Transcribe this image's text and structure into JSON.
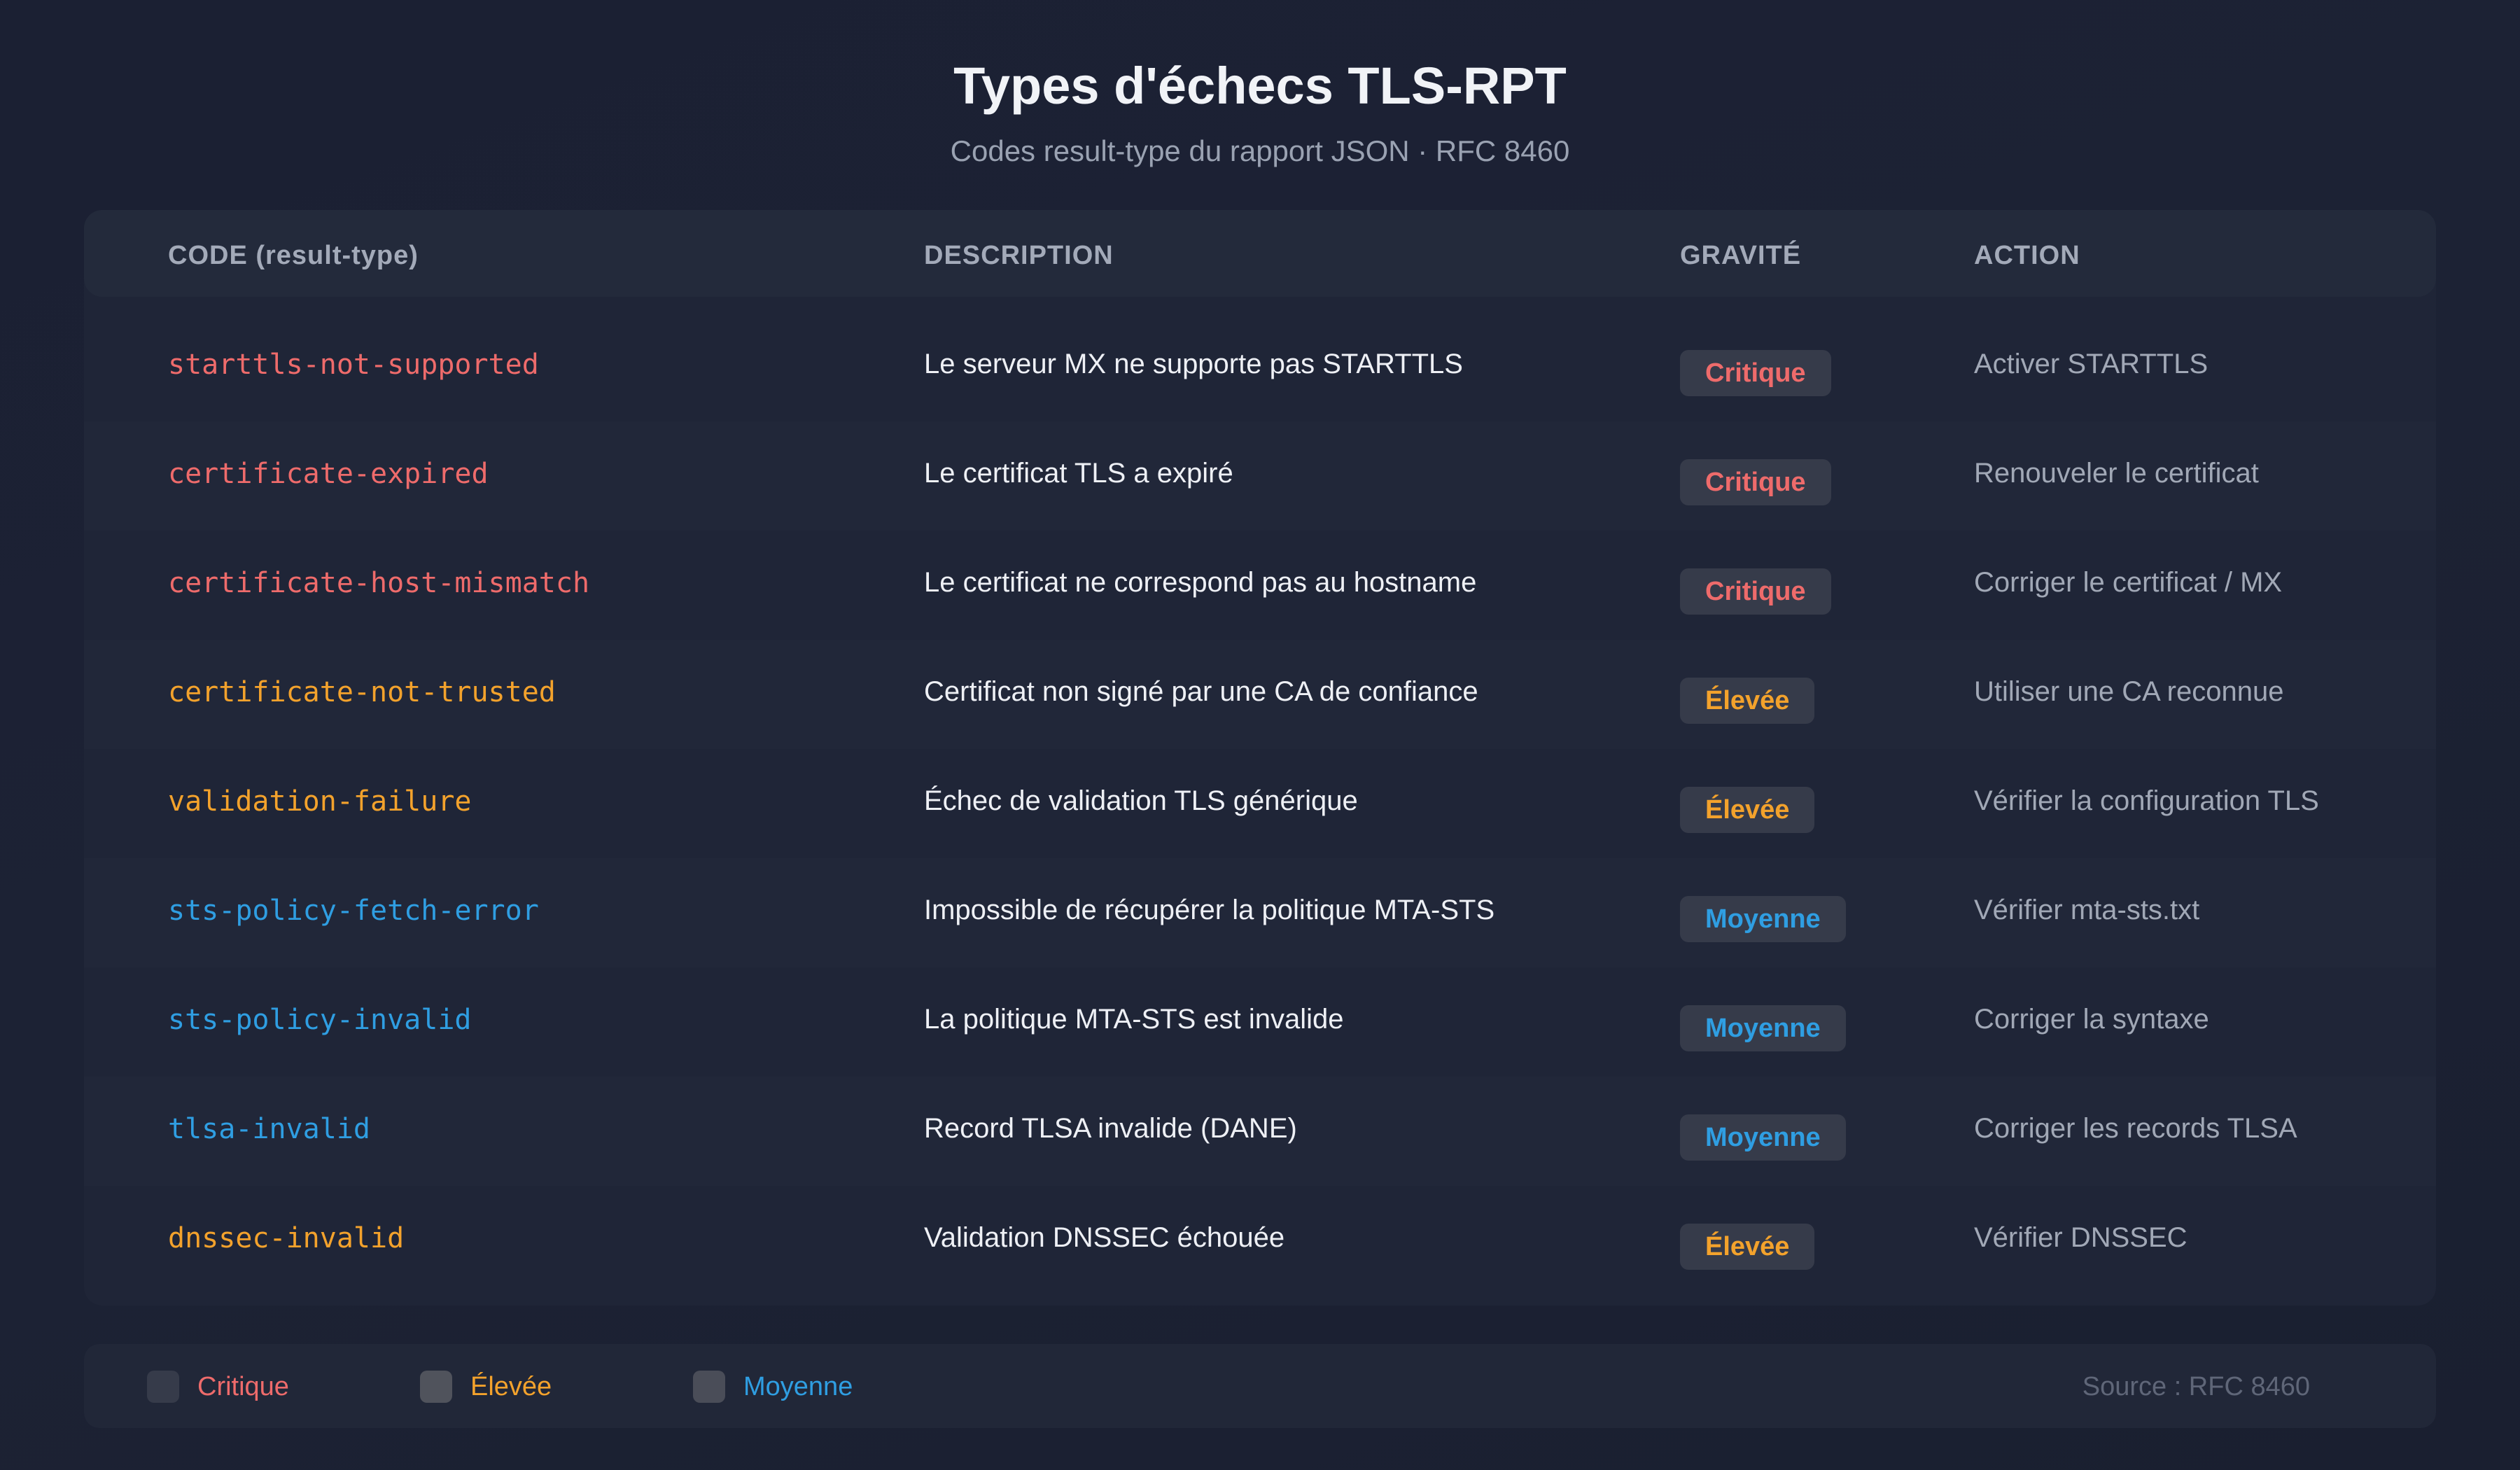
{
  "header": {
    "title": "Types d'échecs TLS-RPT",
    "subtitle": "Codes result-type du rapport JSON · RFC 8460"
  },
  "colors": {
    "background": "#1a1f31",
    "critique": "#ee6b6b",
    "elevee": "#f3a22c",
    "moyenne": "#2f9ee2"
  },
  "table": {
    "columns": [
      "CODE (result-type)",
      "DESCRIPTION",
      "GRAVITÉ",
      "ACTION"
    ],
    "rows": [
      {
        "code": "starttls-not-supported",
        "description": "Le serveur MX ne supporte pas STARTTLS",
        "severity": "Critique",
        "action": "Activer STARTTLS"
      },
      {
        "code": "certificate-expired",
        "description": "Le certificat TLS a expiré",
        "severity": "Critique",
        "action": "Renouveler le certificat"
      },
      {
        "code": "certificate-host-mismatch",
        "description": "Le certificat ne correspond pas au hostname",
        "severity": "Critique",
        "action": "Corriger le certificat / MX"
      },
      {
        "code": "certificate-not-trusted",
        "description": "Certificat non signé par une CA de confiance",
        "severity": "Élevée",
        "action": "Utiliser une CA reconnue"
      },
      {
        "code": "validation-failure",
        "description": "Échec de validation TLS générique",
        "severity": "Élevée",
        "action": "Vérifier la configuration TLS"
      },
      {
        "code": "sts-policy-fetch-error",
        "description": "Impossible de récupérer la politique MTA-STS",
        "severity": "Moyenne",
        "action": "Vérifier mta-sts.txt"
      },
      {
        "code": "sts-policy-invalid",
        "description": "La politique MTA-STS est invalide",
        "severity": "Moyenne",
        "action": "Corriger la syntaxe"
      },
      {
        "code": "tlsa-invalid",
        "description": "Record TLSA invalide (DANE)",
        "severity": "Moyenne",
        "action": "Corriger les records TLSA"
      },
      {
        "code": "dnssec-invalid",
        "description": "Validation DNSSEC échouée",
        "severity": "Élevée",
        "action": "Vérifier DNSSEC"
      }
    ]
  },
  "legend": {
    "items": [
      "Critique",
      "Élevée",
      "Moyenne"
    ],
    "source": "Source : RFC 8460"
  }
}
